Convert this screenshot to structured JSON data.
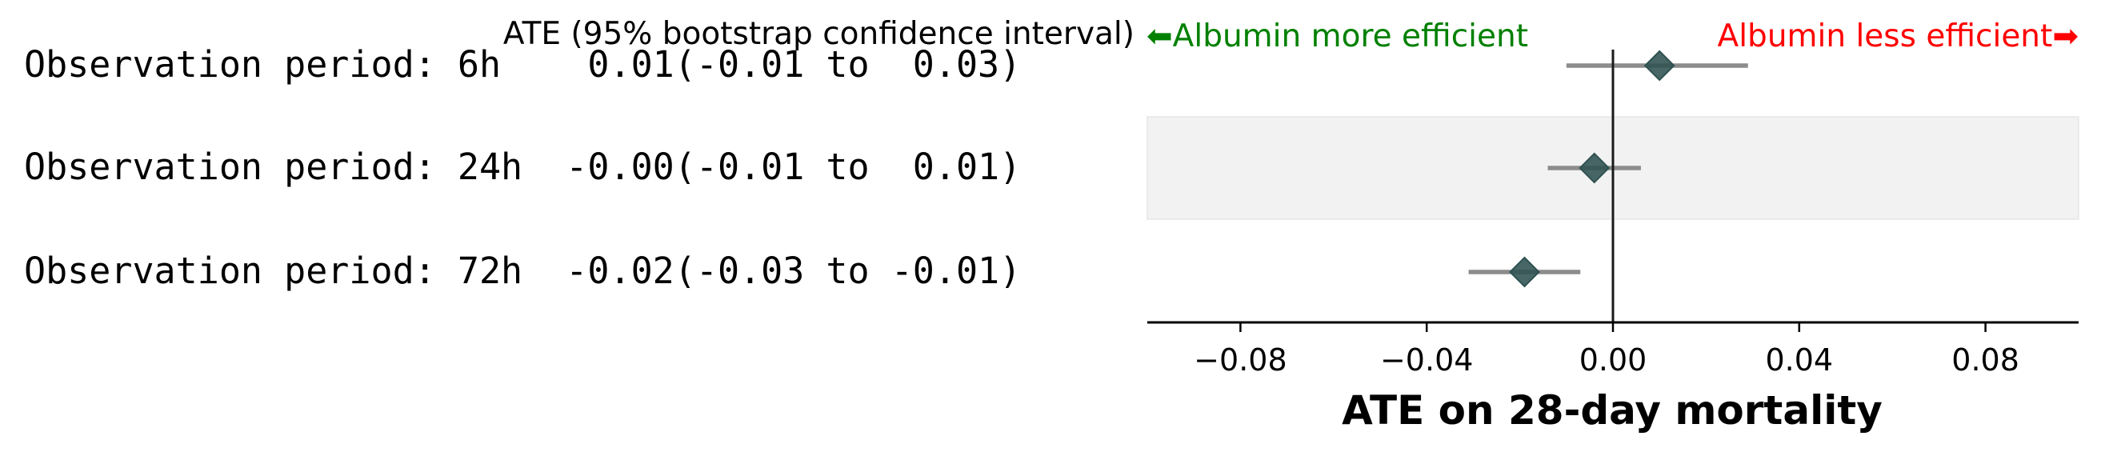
{
  "chart_data": {
    "type": "forest",
    "header": "ATE (95% bootstrap confidence interval)",
    "left_annotation": "⬅Albumin more efficient",
    "right_annotation": "Albumin less efficient➡",
    "colors": {
      "left_annotation": "#008000",
      "right_annotation": "#ff0000",
      "marker": "#2f5151",
      "ci_line": "#8c8c8c",
      "band": "#f2f2f2",
      "axis": "#000000"
    },
    "rows": [
      {
        "label": "Observation period: 6h    0.01(-0.01 to  0.03)",
        "estimate": 0.01,
        "ci_low": -0.01,
        "ci_high": 0.029,
        "shaded": false
      },
      {
        "label": "Observation period: 24h  -0.00(-0.01 to  0.01)",
        "estimate": -0.004,
        "ci_low": -0.014,
        "ci_high": 0.006,
        "shaded": true
      },
      {
        "label": "Observation period: 72h  -0.02(-0.03 to -0.01)",
        "estimate": -0.019,
        "ci_low": -0.031,
        "ci_high": -0.007,
        "shaded": false
      }
    ],
    "xlabel": "ATE on 28-day mortality",
    "xlim": [
      -0.1,
      0.1
    ],
    "xticks": [
      -0.08,
      -0.04,
      0.0,
      0.04,
      0.08
    ],
    "xtick_labels": [
      "−0.08",
      "−0.04",
      "0.00",
      "0.04",
      "0.08"
    ],
    "reference_line": 0.0
  }
}
